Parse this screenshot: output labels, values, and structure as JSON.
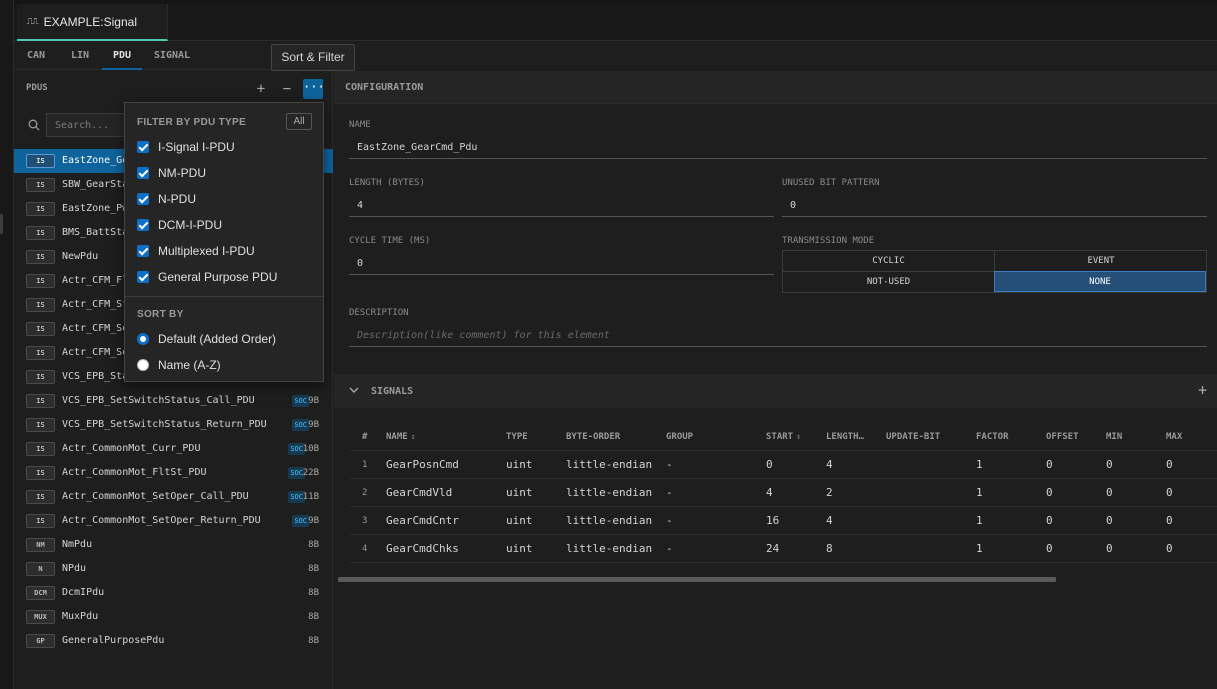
{
  "window": {
    "tab_title": "EXAMPLE:Signal",
    "tab_glyph": "∷"
  },
  "subtabs": [
    "CAN",
    "LIN",
    "PDU",
    "SIGNAL"
  ],
  "active_subtab": "PDU",
  "tooltip": "Sort & Filter",
  "pdus_panel": {
    "title": "PDUS",
    "add": "+",
    "remove": "−",
    "more": "···",
    "search_placeholder": "Search..."
  },
  "pdu_list": [
    {
      "badge": "IS",
      "name": "EastZone_GearCmd_Pdu",
      "soc": "",
      "size": "",
      "selected": true
    },
    {
      "badge": "IS",
      "name": "SBW_GearStatus_Pdu",
      "soc": "",
      "size": ""
    },
    {
      "badge": "IS",
      "name": "EastZone_PwrMode_Pdu",
      "soc": "",
      "size": ""
    },
    {
      "badge": "IS",
      "name": "BMS_BattStatus_Pdu",
      "soc": "",
      "size": ""
    },
    {
      "badge": "IS",
      "name": "NewPdu",
      "soc": "",
      "size": ""
    },
    {
      "badge": "IS",
      "name": "Actr_CFM_FltSt_PDU",
      "soc": "",
      "size": ""
    },
    {
      "badge": "IS",
      "name": "Actr_CFM_St_PDU",
      "soc": "",
      "size": ""
    },
    {
      "badge": "IS",
      "name": "Actr_CFM_SetOper_Call_PDU",
      "soc": "",
      "size": ""
    },
    {
      "badge": "IS",
      "name": "Actr_CFM_SetOper_Return_PDU",
      "soc": "",
      "size": ""
    },
    {
      "badge": "IS",
      "name": "VCS_EPB_Status_PDU",
      "soc": "",
      "size": ""
    },
    {
      "badge": "IS",
      "name": "VCS_EPB_SetSwitchStatus_Call_PDU",
      "soc": "SOC",
      "size": "9B"
    },
    {
      "badge": "IS",
      "name": "VCS_EPB_SetSwitchStatus_Return_PDU",
      "soc": "SOC",
      "size": "9B"
    },
    {
      "badge": "IS",
      "name": "Actr_CommonMot_Curr_PDU",
      "soc": "SOC",
      "size": "10B"
    },
    {
      "badge": "IS",
      "name": "Actr_CommonMot_FltSt_PDU",
      "soc": "SOC",
      "size": "22B"
    },
    {
      "badge": "IS",
      "name": "Actr_CommonMot_SetOper_Call_PDU",
      "soc": "SOC",
      "size": "11B"
    },
    {
      "badge": "IS",
      "name": "Actr_CommonMot_SetOper_Return_PDU",
      "soc": "SOC",
      "size": "9B"
    },
    {
      "badge": "NM",
      "name": "NmPdu",
      "soc": "",
      "size": "8B"
    },
    {
      "badge": "N",
      "name": "NPdu",
      "soc": "",
      "size": "8B"
    },
    {
      "badge": "DCM",
      "name": "DcmIPdu",
      "soc": "",
      "size": "8B"
    },
    {
      "badge": "MUX",
      "name": "MuxPdu",
      "soc": "",
      "size": "8B"
    },
    {
      "badge": "GP",
      "name": "GeneralPurposePdu",
      "soc": "",
      "size": "8B"
    }
  ],
  "filter_menu": {
    "filter_title": "FILTER BY PDU TYPE",
    "all_label": "All",
    "options": [
      "I-Signal I-PDU",
      "NM-PDU",
      "N-PDU",
      "DCM-I-PDU",
      "Multiplexed I-PDU",
      "General Purpose PDU"
    ],
    "sort_title": "SORT BY",
    "sort_options": [
      "Default (Added Order)",
      "Name (A-Z)"
    ],
    "selected_sort": "Default (Added Order)"
  },
  "config": {
    "header": "CONFIGURATION",
    "name_label": "NAME",
    "name_value": "EastZone_GearCmd_Pdu",
    "length_label": "LENGTH (BYTES)",
    "length_value": "4",
    "unused_label": "UNUSED BIT PATTERN",
    "unused_value": "0",
    "cycle_label": "CYCLE TIME (MS)",
    "cycle_value": "0",
    "tm_label": "TRANSMISSION MODE",
    "tm_cells": [
      "CYCLIC",
      "EVENT",
      "NOT-USED",
      "NONE"
    ],
    "tm_selected": "NONE",
    "desc_label": "DESCRIPTION",
    "desc_placeholder": "Description(like comment) for this element"
  },
  "signals": {
    "header": "SIGNALS",
    "add": "+",
    "columns": [
      "#",
      "NAME",
      "TYPE",
      "BYTE-ORDER",
      "GROUP",
      "START",
      "LENGTH…",
      "UPDATE-BIT",
      "FACTOR",
      "OFFSET",
      "MIN",
      "MAX"
    ],
    "rows": [
      {
        "idx": "1",
        "name": "GearPosnCmd",
        "type": "uint",
        "order": "little-endian",
        "group": "-",
        "start": "0",
        "length": "4",
        "update": "",
        "factor": "1",
        "offset": "0",
        "min": "0",
        "max": "0"
      },
      {
        "idx": "2",
        "name": "GearCmdVld",
        "type": "uint",
        "order": "little-endian",
        "group": "-",
        "start": "4",
        "length": "2",
        "update": "",
        "factor": "1",
        "offset": "0",
        "min": "0",
        "max": "0"
      },
      {
        "idx": "3",
        "name": "GearCmdCntr",
        "type": "uint",
        "order": "little-endian",
        "group": "-",
        "start": "16",
        "length": "4",
        "update": "",
        "factor": "1",
        "offset": "0",
        "min": "0",
        "max": "0"
      },
      {
        "idx": "4",
        "name": "GearCmdChks",
        "type": "uint",
        "order": "little-endian",
        "group": "-",
        "start": "24",
        "length": "8",
        "update": "",
        "factor": "1",
        "offset": "0",
        "min": "0",
        "max": "0"
      }
    ]
  },
  "colors": {
    "accent": "#0e639c",
    "tab_underline": "#4ec9b0",
    "soc_badge": "#4fc1ff"
  }
}
